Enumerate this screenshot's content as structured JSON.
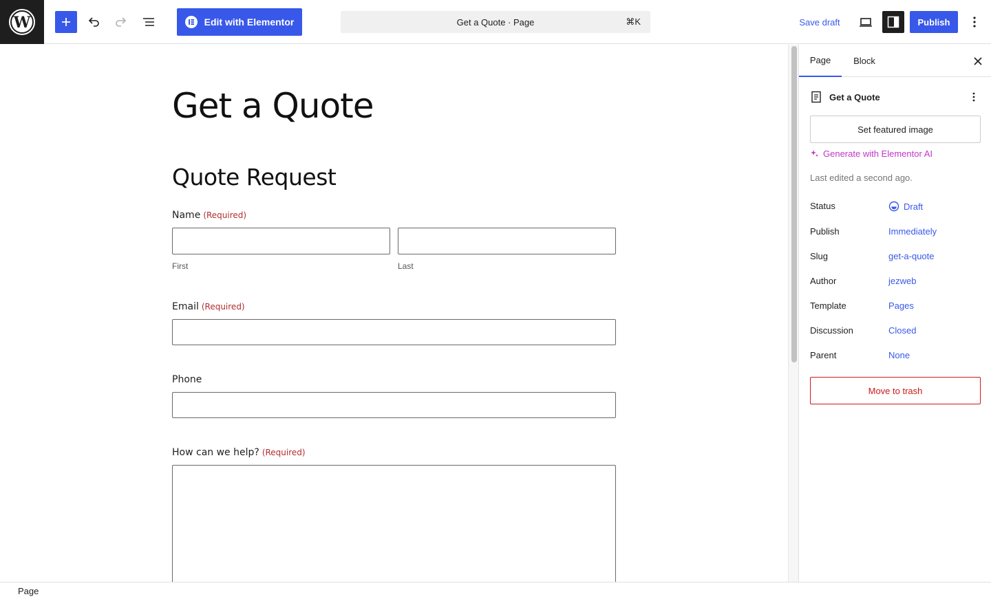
{
  "toolbar": {
    "edit_with_elementor": "Edit with Elementor",
    "command_title": "Get a Quote · Page",
    "command_shortcut": "⌘K",
    "save_draft": "Save draft",
    "publish": "Publish"
  },
  "canvas": {
    "page_title": "Get a Quote",
    "form_title": "Quote Request",
    "required_tag": "(Required)",
    "fields": {
      "name_label": "Name",
      "first_sublabel": "First",
      "last_sublabel": "Last",
      "email_label": "Email",
      "phone_label": "Phone",
      "help_label": "How can we help?"
    }
  },
  "sidebar": {
    "tabs": [
      "Page",
      "Block"
    ],
    "doc_title": "Get a Quote",
    "set_featured_image": "Set featured image",
    "generate_ai": "Generate with Elementor AI",
    "last_edited": "Last edited a second ago.",
    "meta": [
      {
        "key": "Status",
        "value": "Draft"
      },
      {
        "key": "Publish",
        "value": "Immediately"
      },
      {
        "key": "Slug",
        "value": "get-a-quote"
      },
      {
        "key": "Author",
        "value": "jezweb"
      },
      {
        "key": "Template",
        "value": "Pages"
      },
      {
        "key": "Discussion",
        "value": "Closed"
      },
      {
        "key": "Parent",
        "value": "None"
      }
    ],
    "move_to_trash": "Move to trash"
  },
  "footer": {
    "breadcrumb": "Page"
  },
  "colors": {
    "accent": "#3858e9",
    "required": "#b32d2e",
    "ai": "#c036c7",
    "danger": "#cc1818"
  },
  "icons": [
    "wordpress-logo-icon",
    "plus-icon",
    "undo-icon",
    "redo-icon",
    "list-view-icon",
    "elementor-icon",
    "desktop-view-icon",
    "sidebar-toggle-icon",
    "more-vertical-icon",
    "close-icon",
    "page-icon",
    "sparkle-icon",
    "draft-status-icon"
  ]
}
